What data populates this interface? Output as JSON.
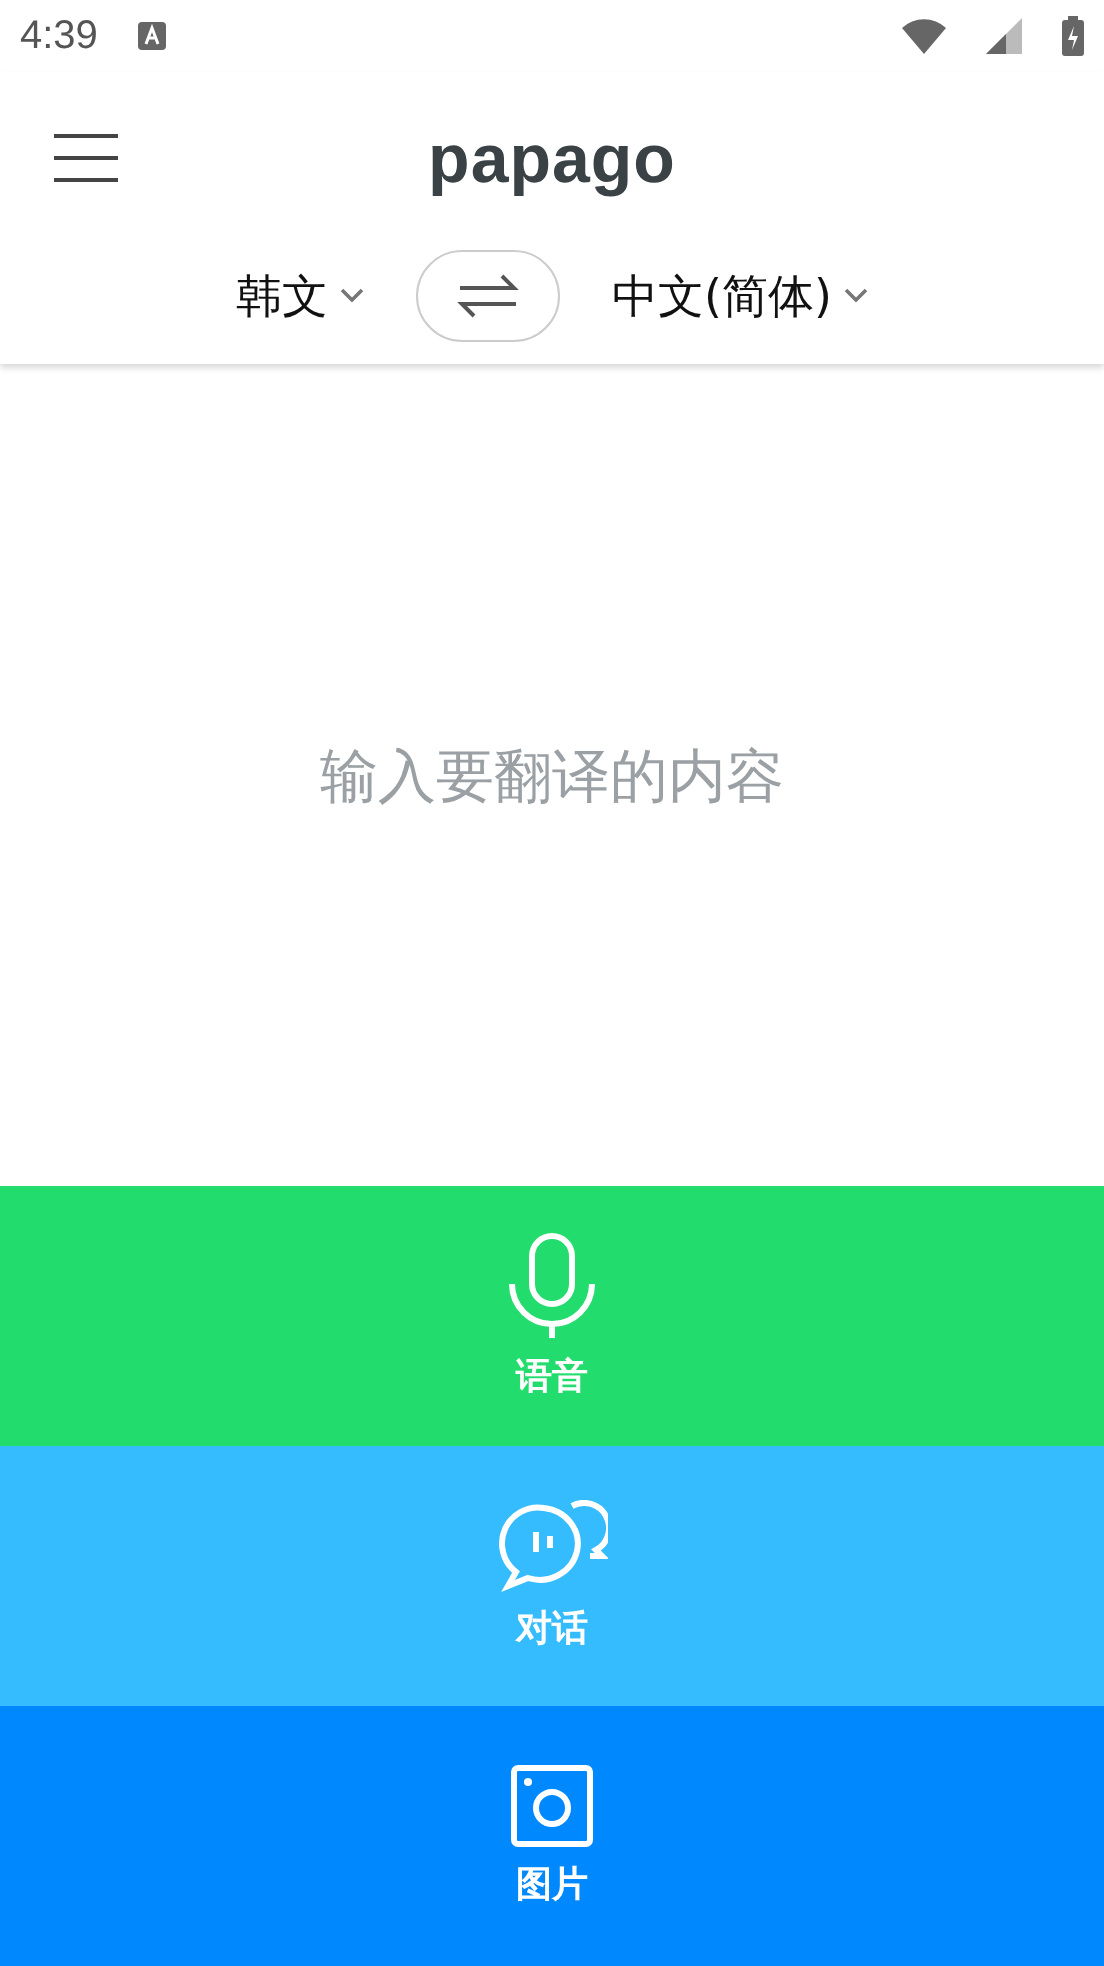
{
  "status_bar": {
    "time": "4:39"
  },
  "header": {
    "logo": "papago",
    "source_language": "韩文",
    "target_language": "中文(简体)"
  },
  "input": {
    "placeholder": "输入要翻译的内容"
  },
  "modes": [
    {
      "kind": "voice",
      "label": "语音",
      "color": "#22dd6e"
    },
    {
      "kind": "conversation",
      "label": "对话",
      "color": "#35bcff"
    },
    {
      "kind": "image",
      "label": "图片",
      "color": "#0088ff"
    }
  ]
}
